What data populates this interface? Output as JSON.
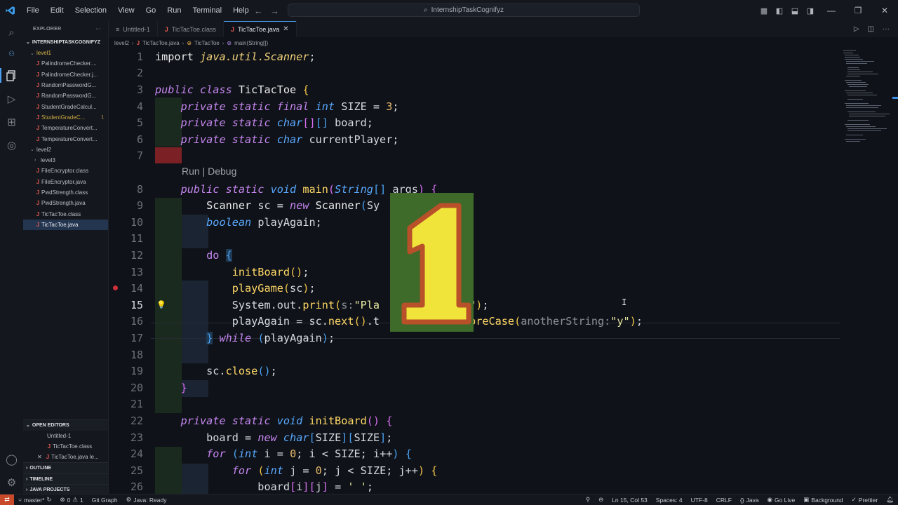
{
  "menu": [
    "File",
    "Edit",
    "Selection",
    "View",
    "Go",
    "Run",
    "Terminal",
    "Help"
  ],
  "search": {
    "text": "InternshipTaskCognifyz"
  },
  "sidebar": {
    "title": "EXPLORER",
    "project": "INTERNSHIPTASKCOGNIFYZ",
    "folder_level1": "level1",
    "level1_files": [
      "PalindromeChecker....",
      "PalindromeChecker.j...",
      "RandomPasswordG...",
      "RandomPasswordG...",
      "StudentGradeCalcul...",
      "StudentGradeC...",
      "TemperatureConvert...",
      "TemperatureConvert..."
    ],
    "warn_count": "1",
    "folder_level2": "level2",
    "folder_level3": "level3",
    "level2_files": [
      "FileEncryptor.class",
      "FileEncryptor.java",
      "PwdStrength.class",
      "PwdStrength.java",
      "TicTacToe.class",
      "TicTacToe.java"
    ],
    "open_editors_title": "OPEN EDITORS",
    "open_editors": [
      "Untitled-1",
      "TicTacToe.class",
      "TicTacToe.java le..."
    ],
    "outline": "OUTLINE",
    "timeline": "TIMELINE",
    "java_projects": "JAVA PROJECTS"
  },
  "tabs": [
    {
      "label": "Untitled-1"
    },
    {
      "label": "TicTacToe.class"
    },
    {
      "label": "TicTacToe.java"
    }
  ],
  "breadcrumb": [
    "level2",
    "TicTacToe.java",
    "TicTacToe",
    "main(String[])"
  ],
  "code": {
    "line_numbers": [
      "1",
      "2",
      "3",
      "4",
      "5",
      "6",
      "7",
      "8",
      "9",
      "10",
      "11",
      "12",
      "13",
      "14",
      "15",
      "16",
      "17",
      "18",
      "19",
      "20",
      "21",
      "22",
      "23",
      "24",
      "25",
      "26"
    ],
    "codelens": "Run | Debug",
    "overlay_glyph": "1"
  },
  "status": {
    "branch": "master*",
    "problems_errors": "0",
    "problems_warnings": "1",
    "git_graph": "Git Graph",
    "java_status": "Java: Ready",
    "position": "Ln 15, Col 53",
    "spaces": "Spaces: 4",
    "encoding": "UTF-8",
    "eol": "CRLF",
    "language": "Java",
    "go_live": "Go Live",
    "background": "Background",
    "prettier": "Prettier"
  },
  "colors": {
    "accent": "#4aa0f0",
    "keyword": "#c586f0",
    "type": "#59a9ff",
    "function": "#ffd866",
    "error": "#e0584e",
    "remote": "#c84a2a"
  }
}
